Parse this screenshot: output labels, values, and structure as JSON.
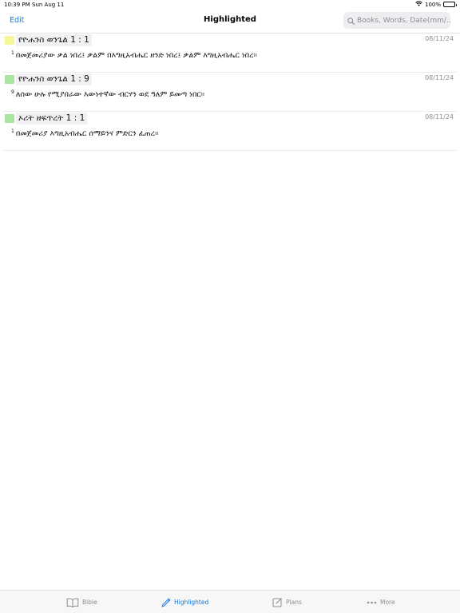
{
  "status_bar": {
    "time": "10:39 PM",
    "date": "Sun Aug 11",
    "battery": "100%"
  },
  "nav": {
    "edit_label": "Edit",
    "title": "Highlighted",
    "search_placeholder": "Books, Words, Date(mm/..."
  },
  "highlights": [
    {
      "color": "#f7f59a",
      "reference": "የዮሐንስ ወንጌል 1 : 1",
      "date": "08/11/24",
      "verse_num": "1",
      "text": "በመጀመሪያው ቃል ነበረ፤ ቃልም በእግዚአብሔር ዘንድ ነበረ፤ ቃልም እግዚአብሔር ነበረ።"
    },
    {
      "color": "#a8e6a0",
      "reference": "የዮሐንስ ወንጌል 1 : 9",
      "date": "08/11/24",
      "verse_num": "9",
      "text": "ለሰው ሁሉ የሚያበራው እውነተኛው ብርሃን ወደ ዓለም ይመጣ ነበር።"
    },
    {
      "color": "#a8e6a0",
      "reference": "ኦሪት ዘፍጥረት 1 : 1",
      "date": "08/11/24",
      "verse_num": "1",
      "text": "በመጀመሪያ እግዚአብሔር ሰማይንና ምድርን ፈጠረ።"
    }
  ],
  "tabs": [
    {
      "label": "Bible",
      "icon": "book-icon",
      "active": false
    },
    {
      "label": "Highlighted",
      "icon": "highlighter-icon",
      "active": true
    },
    {
      "label": "Plans",
      "icon": "plans-icon",
      "active": false
    },
    {
      "label": "More",
      "icon": "more-dots-icon",
      "active": false
    }
  ],
  "colors": {
    "accent": "#1877e0",
    "inactive": "#8e8e93"
  }
}
